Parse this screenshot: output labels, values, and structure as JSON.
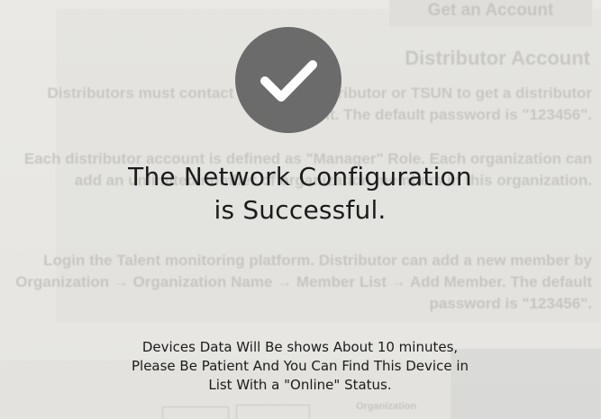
{
  "background": {
    "top_button_label": "Get an Account",
    "heading": "Distributor Account",
    "para1": "Distributors must contact the talent distributor or TSUN to get a distributor account. The default password is \"123456\".",
    "para2": "Each distributor account is defined as \"Manager\" Role. Each organization can add an unlimited number of organization members in this organization.",
    "para3": "Login the Talent monitoring platform. Distributor can add a new member by Organization → Organization Name → Member List → Add Member. The default password is \"123456\".",
    "bottom_label": "Organization"
  },
  "dialog": {
    "icon": "checkmark-icon",
    "icon_color": "#6b6b6b",
    "title_line1": "The Network Configuration",
    "title_line2": "is Successful.",
    "info_line1": "Devices Data Will Be shows About 10 minutes,",
    "info_line2": "Please Be Patient And You Can Find This Device in",
    "info_line3": "List With a \"Online\" Status."
  }
}
